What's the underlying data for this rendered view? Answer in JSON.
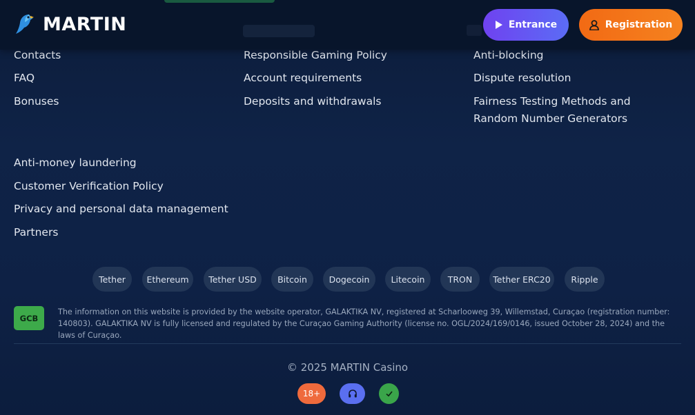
{
  "header": {
    "brand": "MARTIN",
    "entrance_label": "Entrance",
    "registration_label": "Registration"
  },
  "footer_links": {
    "col1": [
      "Contacts",
      "FAQ",
      "Bonuses"
    ],
    "col2": [
      "Responsible Gaming Policy",
      "Account requirements",
      "Deposits and withdrawals"
    ],
    "col3": [
      "Anti-blocking",
      "Dispute resolution",
      "Fairness Testing Methods and Random Number Generators"
    ],
    "extra": [
      "Anti-money laundering",
      "Customer Verification Policy",
      "Privacy and personal data management",
      "Partners"
    ]
  },
  "payment_methods": [
    "Tether",
    "Ethereum",
    "Tether USD",
    "Bitcoin",
    "Dogecoin",
    "Litecoin",
    "TRON",
    "Tether ERC20",
    "Ripple"
  ],
  "license": {
    "badge": "GCB",
    "text": "The information on this website is provided by the website operator, GALAKTIKA NV, registered at Scharlooweg 39, Willemstad, Curaçao (registration number: 140803). GALAKTIKA NV is fully licensed and regulated by the Curaçao Gaming Authority (license no. OGL/2024/169/0146, issued October 28, 2024) and the laws of Curaçao."
  },
  "copyright": "© 2025 MARTIN Casino",
  "badges": {
    "age": "18+",
    "support_icon": "headphones-icon",
    "verified_icon": "check-icon"
  },
  "colors": {
    "entrance": "#6f42f0",
    "registration": "#f26a14",
    "gcb": "#3daa4a",
    "age_badge": "#ef6a3c",
    "support_badge": "#5a6ff0",
    "check_badge": "#3aa54a"
  }
}
